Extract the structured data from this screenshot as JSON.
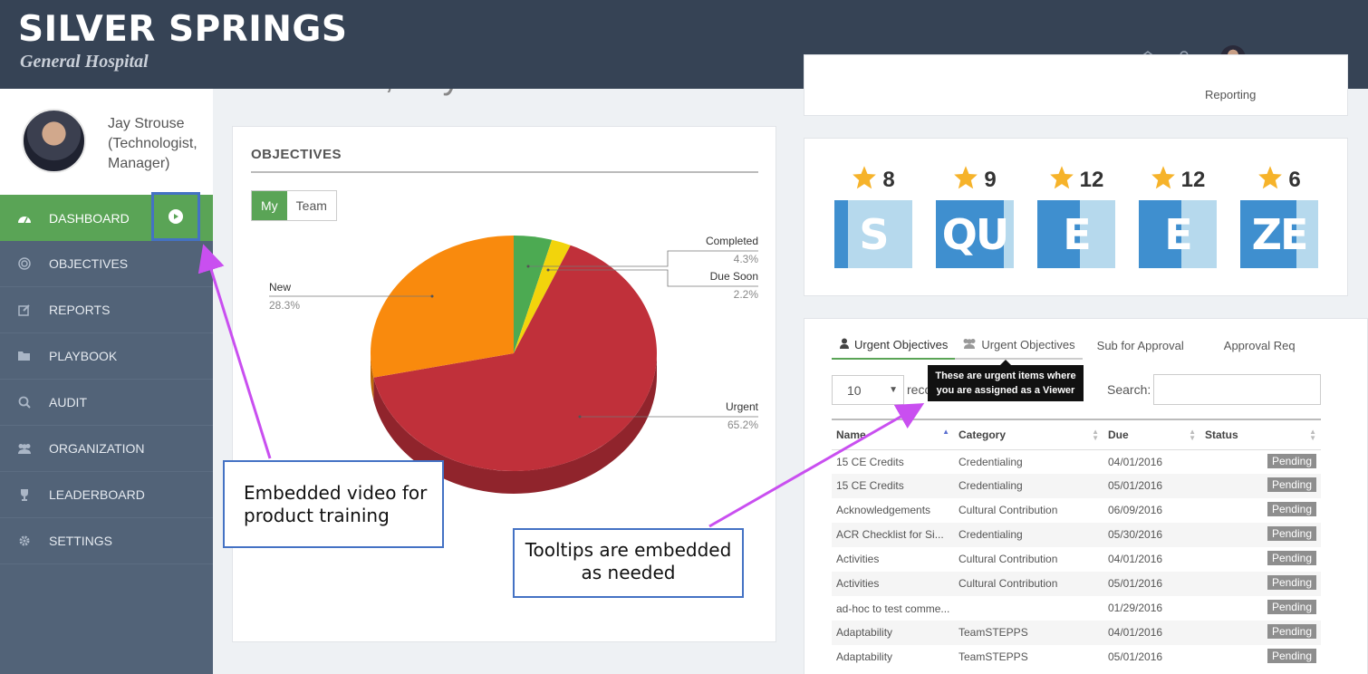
{
  "header": {
    "brand_name": "SILVER SPRINGS",
    "brand_sub": "General Hospital",
    "user_name": "Jay Strouse"
  },
  "profile": {
    "name": "Jay Strouse (Technologist, Manager)"
  },
  "nav": [
    {
      "label": "DASHBOARD",
      "icon": "dashboard-icon"
    },
    {
      "label": "OBJECTIVES",
      "icon": "target-icon"
    },
    {
      "label": "REPORTS",
      "icon": "edit-icon"
    },
    {
      "label": "PLAYBOOK",
      "icon": "folder-icon"
    },
    {
      "label": "AUDIT",
      "icon": "search-icon"
    },
    {
      "label": "ORGANIZATION",
      "icon": "users-icon"
    },
    {
      "label": "LEADERBOARD",
      "icon": "trophy-icon"
    },
    {
      "label": "SETTINGS",
      "icon": "gear-icon"
    }
  ],
  "welcome": "Welcome, Jay!",
  "objectives": {
    "title": "OBJECTIVES",
    "toggle_my": "My",
    "toggle_team": "Team"
  },
  "chart_data": {
    "type": "pie",
    "slices": [
      {
        "label": "Completed",
        "value": 4.3,
        "display": "4.3%",
        "color": "#4caa52"
      },
      {
        "label": "Due Soon",
        "value": 2.2,
        "display": "2.2%",
        "color": "#f2d40c"
      },
      {
        "label": "Urgent",
        "value": 65.2,
        "display": "65.2%",
        "color": "#c0303a"
      },
      {
        "label": "New",
        "value": 28.3,
        "display": "28.3%",
        "color": "#f98a0d"
      }
    ]
  },
  "reporting_label": "Reporting",
  "squeeze": [
    {
      "score": "8",
      "letters": "S",
      "fill": 0.18
    },
    {
      "score": "9",
      "letters": "QU",
      "fill": 0.87
    },
    {
      "score": "12",
      "letters": "E",
      "fill": 0.55
    },
    {
      "score": "12",
      "letters": "E",
      "fill": 0.55
    },
    {
      "score": "6",
      "letters": "ZE",
      "fill": 0.72
    }
  ],
  "urgent": {
    "tabs": [
      "Urgent Objectives",
      "Urgent Objectives",
      "Sub for Approval",
      "Approval Req"
    ],
    "tooltip": "These are urgent items where you are assigned as a Viewer",
    "length_value": "10",
    "length_suffix": "reco",
    "search_label": "Search:",
    "columns": [
      "Name",
      "Category",
      "Due",
      "Status"
    ],
    "rows": [
      [
        "15 CE Credits",
        "Credentialing",
        "04/01/2016",
        "Pending"
      ],
      [
        "15 CE Credits",
        "Credentialing",
        "05/01/2016",
        "Pending"
      ],
      [
        "Acknowledgements",
        "Cultural Contribution",
        "06/09/2016",
        "Pending"
      ],
      [
        "ACR Checklist for Si...",
        "Credentialing",
        "05/30/2016",
        "Pending"
      ],
      [
        "Activities",
        "Cultural Contribution",
        "04/01/2016",
        "Pending"
      ],
      [
        "Activities",
        "Cultural Contribution",
        "05/01/2016",
        "Pending"
      ],
      [
        "ad-hoc to test comme...",
        "",
        "01/29/2016",
        "Pending"
      ],
      [
        "Adaptability",
        "TeamSTEPPS",
        "04/01/2016",
        "Pending"
      ],
      [
        "Adaptability",
        "TeamSTEPPS",
        "05/01/2016",
        "Pending"
      ]
    ]
  },
  "annotations": {
    "video": "Embedded video for product training",
    "tooltips": "Tooltips are embedded as needed"
  }
}
